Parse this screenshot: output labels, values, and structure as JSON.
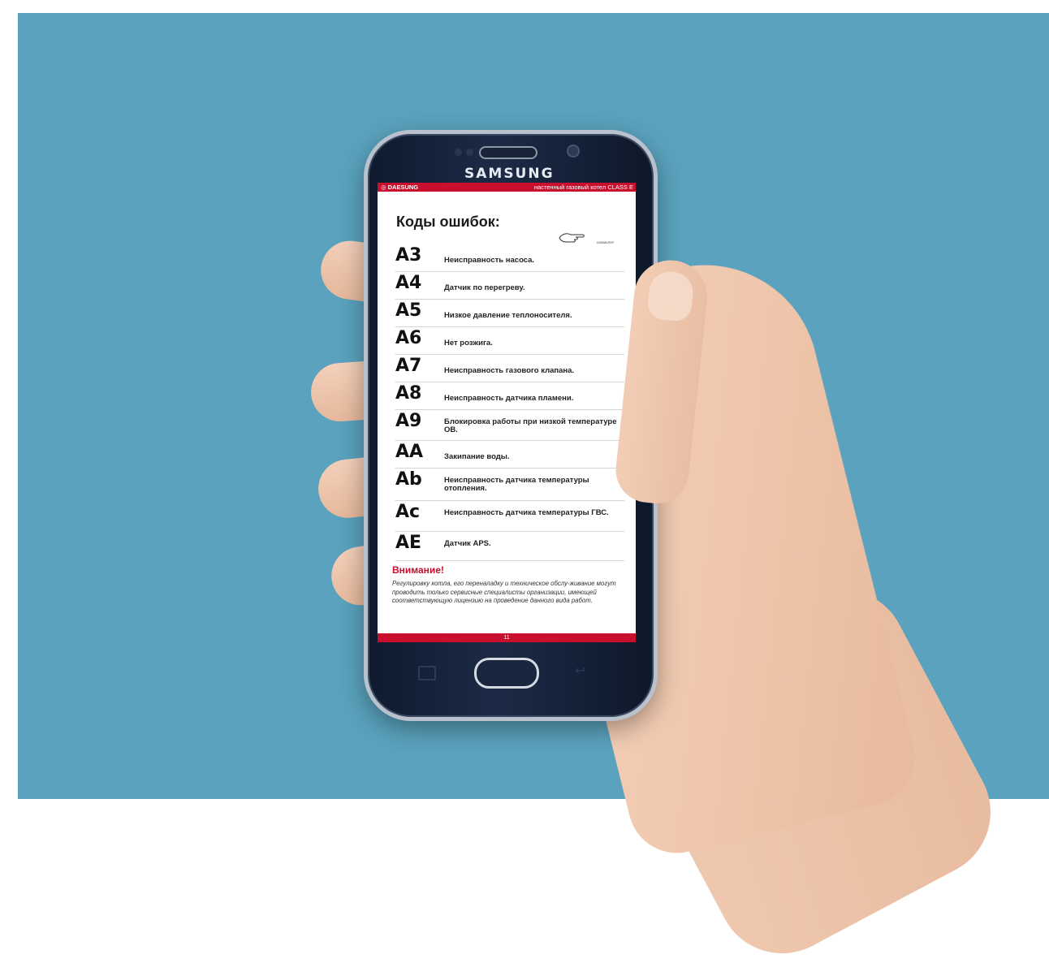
{
  "device": {
    "brand": "SAMSUNG"
  },
  "header": {
    "logo": "◎ DAESUNG",
    "model": "настенный газовый котел CLASS E"
  },
  "page_title": "Коды ошибок:",
  "hint": "нажмите!",
  "errors": [
    {
      "code": "A3",
      "desc": "Неисправность насоса."
    },
    {
      "code": "A4",
      "desc": "Датчик по перегреву."
    },
    {
      "code": "A5",
      "desc": "Низкое давление теплоносителя."
    },
    {
      "code": "A6",
      "desc": "Нет розжига."
    },
    {
      "code": "A7",
      "desc": "Неисправность газового клапана."
    },
    {
      "code": "A8",
      "desc": "Неисправность датчика пламени."
    },
    {
      "code": "A9",
      "desc": "Блокировка работы при низкой температуре ОВ."
    },
    {
      "code": "AA",
      "desc": "Закипание воды."
    },
    {
      "code": "Ab",
      "desc": "Неисправность датчика температуры отопления."
    },
    {
      "code": "Ac",
      "desc": "Неисправность датчика температуры ГВС."
    },
    {
      "code": "AE",
      "desc": "Датчик APS."
    }
  ],
  "warning": {
    "title": "Внимание!",
    "text": "Регулировку котла, его переналадку и техническое обслу-живание могут проводить только сервисные специалисты организации, имеющей соответствующую лицензию на проведение данного вида работ."
  },
  "page_number": "11",
  "colors": {
    "background": "#5aa2bd",
    "accent": "#c8102e",
    "phone_body": "#1c2a46"
  }
}
